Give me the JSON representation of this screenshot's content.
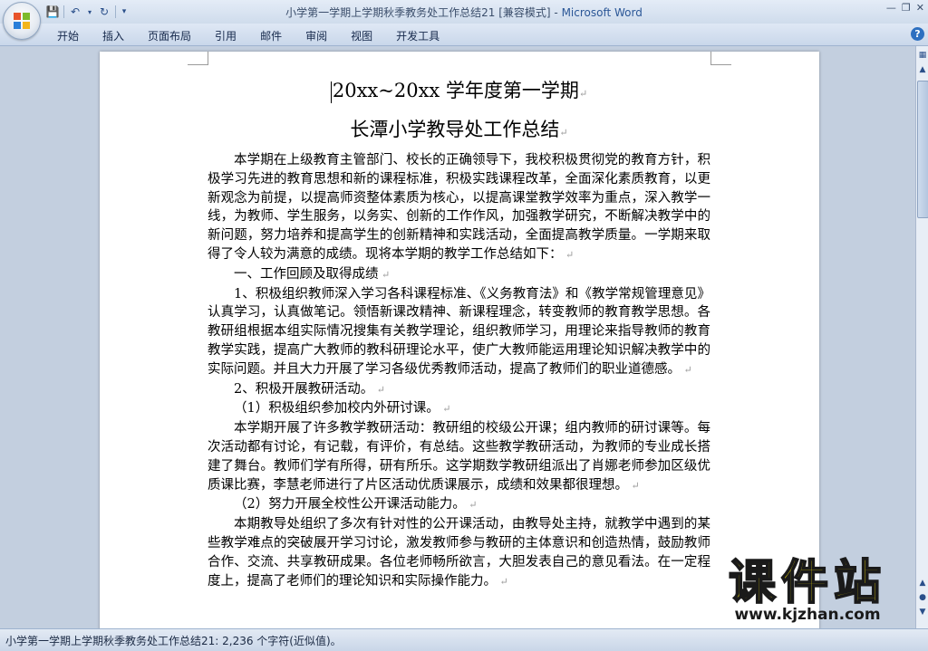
{
  "window": {
    "doc_title": "小学第一学期上学期秋季教务处工作总结21 [兼容模式] - ",
    "app_name": "Microsoft Word"
  },
  "ribbon": {
    "tabs": [
      "开始",
      "插入",
      "页面布局",
      "引用",
      "邮件",
      "审阅",
      "视图",
      "开发工具"
    ]
  },
  "document": {
    "title1": "20xx~20xx 学年度第一学期",
    "title2": "长潭小学教导处工作总结",
    "paragraphs": [
      {
        "text": "本学期在上级教育主管部门、校长的正确领导下，我校积极贯彻党的教育方针，积极学习先进的教育思想和新的课程标准，积极实践课程改革，全面深化素质教育，以更新观念为前提，以提高师资整体素质为核心，以提高课堂教学效率为重点，深入教学一线，为教师、学生服务，以务实、创新的工作作风，加强教学研究，不断解决教学中的新问题，努力培养和提高学生的创新精神和实践活动，全面提高教学质量。一学期来取得了令人较为满意的成绩。现将本学期的教学工作总结如下：",
        "indent": true
      },
      {
        "text": "一、工作回顾及取得成绩",
        "indent": true
      },
      {
        "text": "1、积极组织教师深入学习各科课程标准、《义务教育法》和《教学常规管理意见》认真学习，认真做笔记。领悟新课改精神、新课程理念，转变教师的教育教学思想。各教研组根据本组实际情况搜集有关教学理论，组织教师学习，用理论来指导教师的教育教学实践，提高广大教师的教科研理论水平，使广大教师能运用理论知识解决教学中的实际问题。并且大力开展了学习各级优秀教师活动，提高了教师们的职业道德感。",
        "indent": true
      },
      {
        "text": "2、积极开展教研活动。",
        "indent": true
      },
      {
        "text": "（1）积极组织参加校内外研讨课。",
        "indent": true
      },
      {
        "text": "本学期开展了许多教学教研活动：教研组的校级公开课；组内教师的研讨课等。每次活动都有讨论，有记载，有评价，有总结。这些教学教研活动，为教师的专业成长搭建了舞台。教师们学有所得，研有所乐。这学期数学教研组派出了肖娜老师参加区级优质课比赛，李慧老师进行了片区活动优质课展示，成绩和效果都很理想。",
        "indent": true
      },
      {
        "text": "（2）努力开展全校性公开课活动能力。",
        "indent": true
      },
      {
        "text": "本期教导处组织了多次有针对性的公开课活动，由教导处主持，就教学中遇到的某些教学难点的突破展开学习讨论，激发教师参与教研的主体意识和创造热情，鼓励教师合作、交流、共享教研成果。各位老师畅所欲言，大胆发表自己的意见看法。在一定程度上，提高了老师们的理论知识和实际操作能力。",
        "indent": true
      }
    ]
  },
  "watermark": {
    "cn": "课件站",
    "url": "www.kjzhan.com"
  },
  "statusbar": {
    "text": "小学第一学期上学期秋季教务处工作总结21: 2,236 个字符(近似值)。"
  },
  "icons": {
    "office": "office-button-icon",
    "save": "save-icon",
    "undo": "undo-icon",
    "redo": "redo-icon",
    "help": "help-icon"
  },
  "colors": {
    "brand": "#2b5797",
    "watermark_fill": "#f4e10e"
  }
}
